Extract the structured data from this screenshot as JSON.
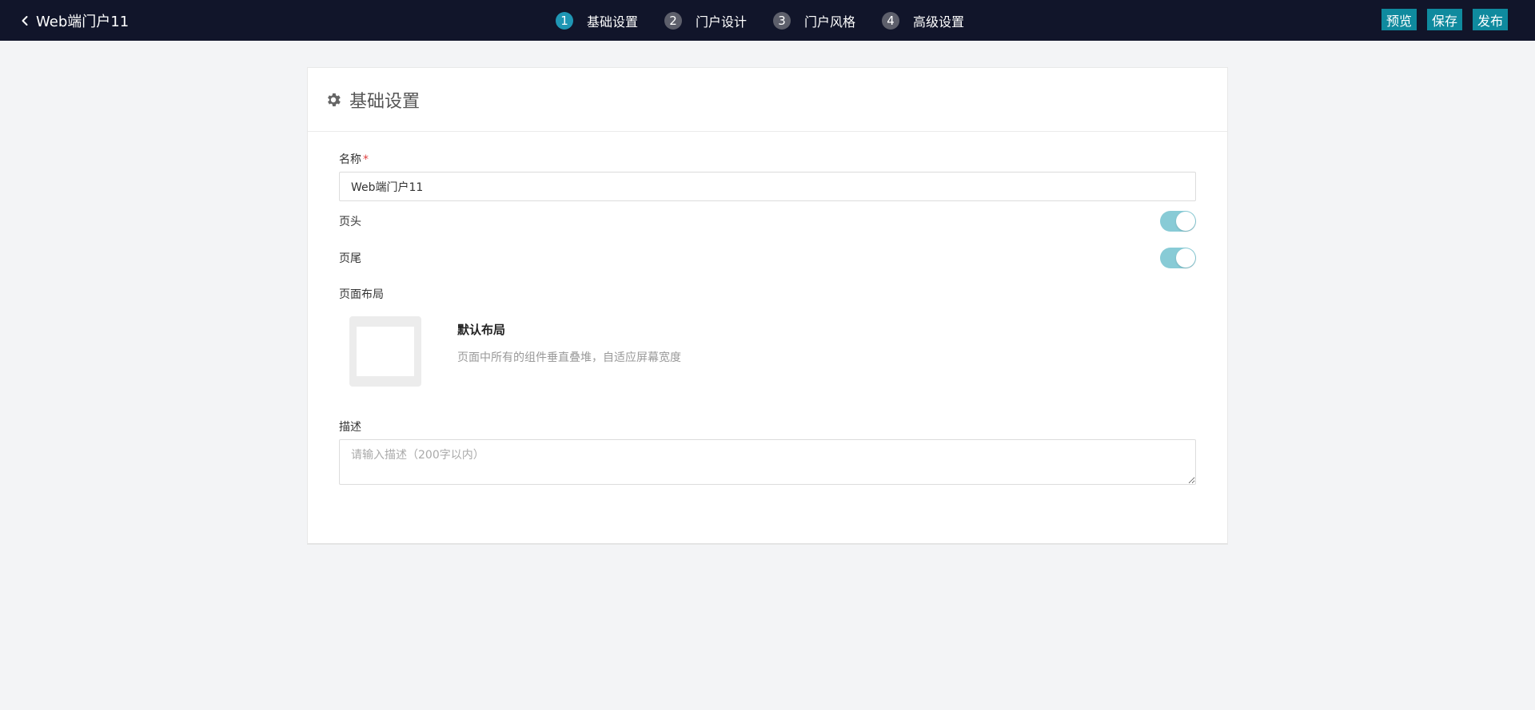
{
  "topbar": {
    "back_title": "Web端门户11",
    "steps": [
      {
        "num": "1",
        "label": "基础设置"
      },
      {
        "num": "2",
        "label": "门户设计"
      },
      {
        "num": "3",
        "label": "门户风格"
      },
      {
        "num": "4",
        "label": "高级设置"
      }
    ],
    "active_step": 1,
    "actions": {
      "preview": "预览",
      "save": "保存",
      "publish": "发布"
    },
    "colors": {
      "bar": "#11152a",
      "active_step": "#1f96b4",
      "button": "#0f8a9e"
    }
  },
  "card": {
    "heading": "基础设置",
    "heading_icon": "gear-icon",
    "name_label": "名称",
    "name_required_mark": "*",
    "name_value": "Web端门户11",
    "header_label": "页头",
    "header_enabled": true,
    "footer_label": "页尾",
    "footer_enabled": true,
    "layout_label": "页面布局",
    "layout_option_name": "默认布局",
    "layout_option_desc": "页面中所有的组件垂直叠堆，自适应屏幕宽度",
    "description_label": "描述",
    "description_placeholder": "请输入描述（200字以内）",
    "toggle_color": "#88cbd6"
  }
}
